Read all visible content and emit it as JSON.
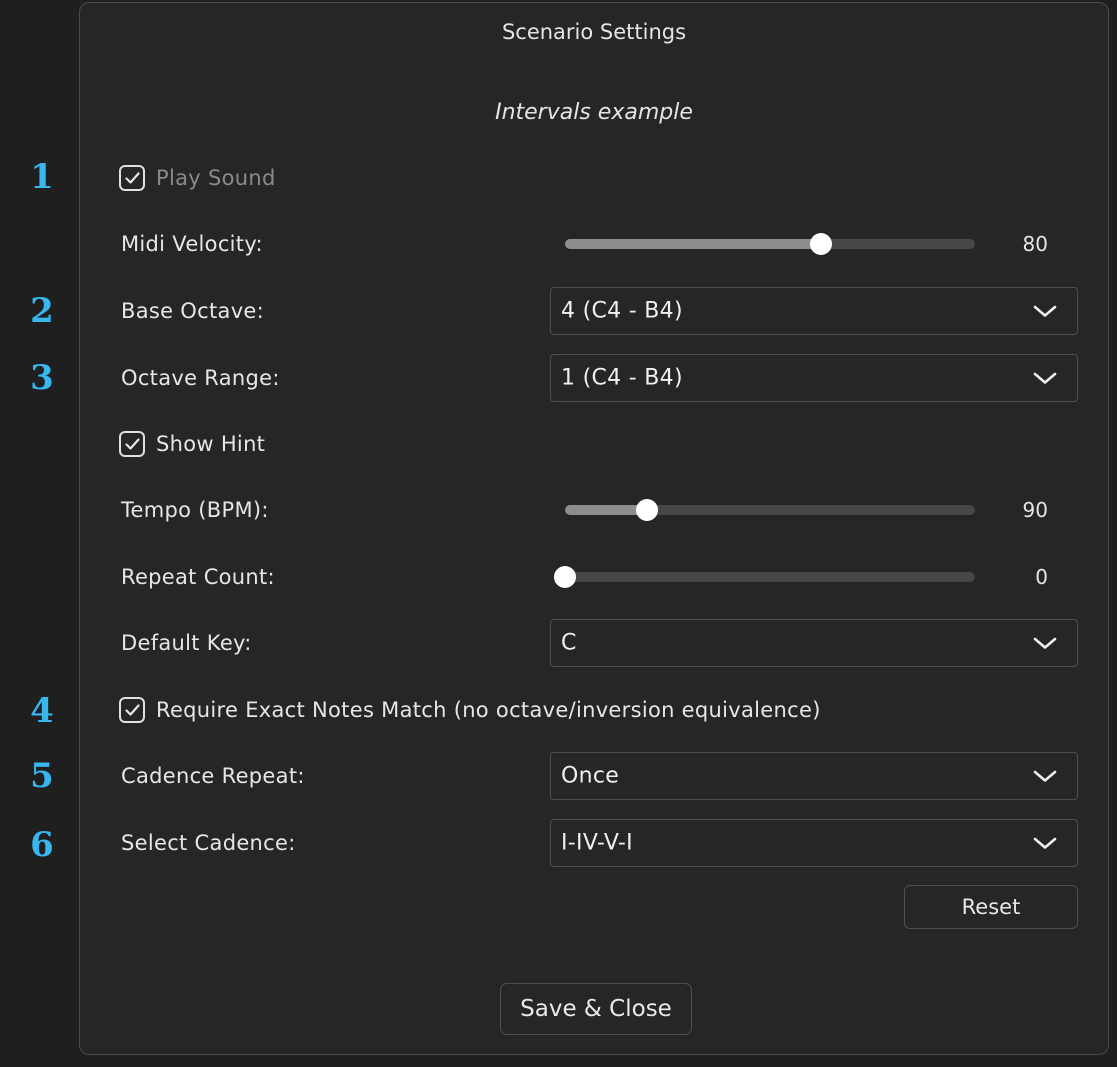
{
  "dialog": {
    "title": "Scenario Settings",
    "scenario_name": "Intervals example"
  },
  "markers": [
    "1",
    "2",
    "3",
    "4",
    "5",
    "6"
  ],
  "settings": {
    "play_sound": {
      "label": "Play Sound",
      "checked": true,
      "disabled": true
    },
    "midi_velocity": {
      "label": "Midi Velocity:",
      "value": "80",
      "fraction": 0.625
    },
    "base_octave": {
      "label": "Base Octave:",
      "value": "4 (C4 - B4)"
    },
    "octave_range": {
      "label": "Octave Range:",
      "value": "1 (C4 - B4)"
    },
    "show_hint": {
      "label": "Show Hint",
      "checked": true
    },
    "tempo": {
      "label": "Tempo (BPM):",
      "value": "90",
      "fraction": 0.2
    },
    "repeat_count": {
      "label": "Repeat Count:",
      "value": "0",
      "fraction": 0.0
    },
    "default_key": {
      "label": "Default Key:",
      "value": "C"
    },
    "exact_match": {
      "label": "Require Exact Notes Match (no octave/inversion equivalence)",
      "checked": true
    },
    "cadence_repeat": {
      "label": "Cadence Repeat:",
      "value": "Once"
    },
    "select_cadence": {
      "label": "Select Cadence:",
      "value": "I-IV-V-I"
    }
  },
  "buttons": {
    "reset": "Reset",
    "save_close": "Save & Close"
  },
  "colors": {
    "background": "#1f1f1f",
    "dialog": "#262626",
    "marker": "#38b6f0",
    "slider_fill": "#8d8d8d",
    "slider_track": "#474747"
  },
  "icons": {
    "checkbox": "check-icon",
    "select": "chevron-down-icon"
  }
}
